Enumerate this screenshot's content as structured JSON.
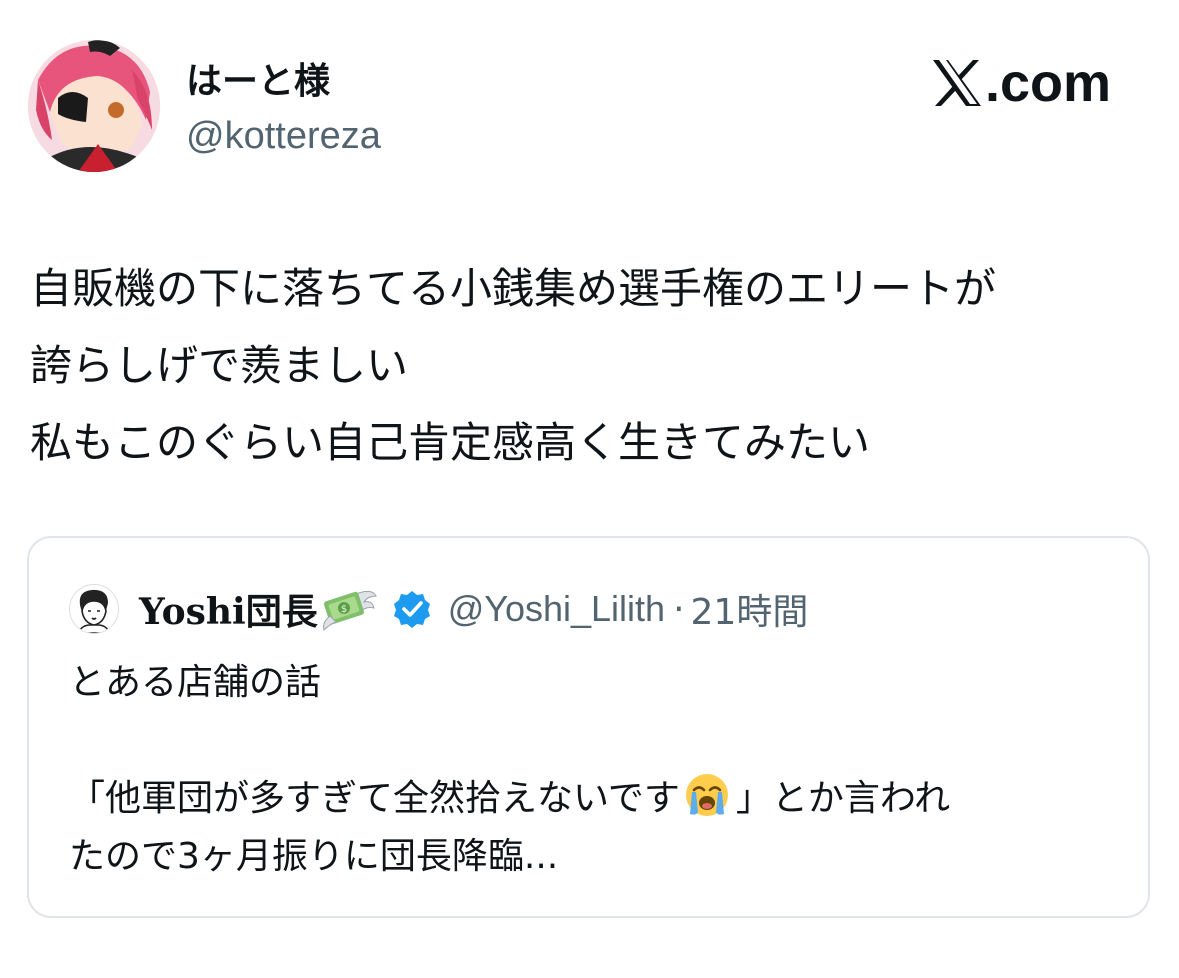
{
  "author": {
    "display_name": "はーと様",
    "handle": "@kottereza"
  },
  "brand": {
    "label": ".com",
    "icon": "x-logo-icon"
  },
  "tweet": {
    "lines": [
      "自販機の下に落ちてる小銭集め選手権のエリートが",
      "誇らしげで羨ましい",
      "私もこのぐらい自己肯定感高く生きてみたい"
    ]
  },
  "quote": {
    "display_name": "Yoshi団長",
    "name_emoji": "money-with-wings-icon",
    "verified_icon": "verified-badge-icon",
    "verified_color": "#1d9bf0",
    "handle": "@Yoshi_Lilith",
    "separator": "·",
    "time": "21時間",
    "line1": "とある店舗の話",
    "line2_a": "「他軍団が多すぎて全然拾えないです",
    "line2_emoji": "loudly-crying-face-icon",
    "line2_b": "」とか言われ",
    "line3": "たので3ヶ月振りに団長降臨..."
  }
}
